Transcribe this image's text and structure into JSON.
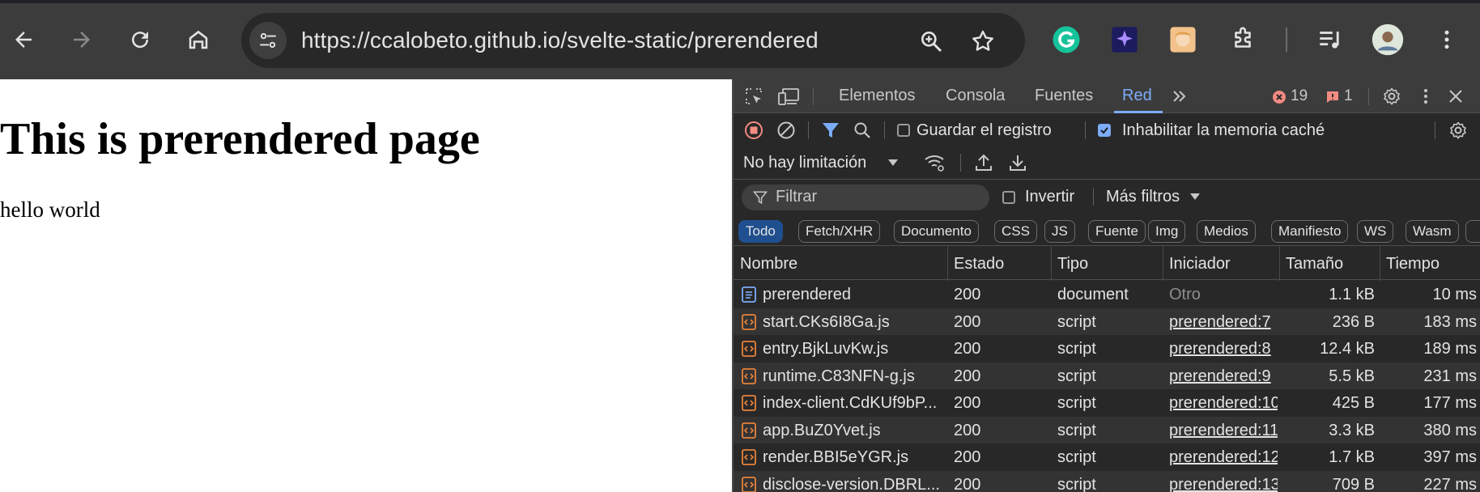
{
  "browser": {
    "url": "https://ccalobeto.github.io/svelte-static/prerendered",
    "icons": {
      "back": "back-arrow-icon",
      "forward": "forward-arrow-icon",
      "reload": "reload-icon",
      "home": "home-icon",
      "site_info": "site-info-icon",
      "zoom": "zoom-icon",
      "bookmark": "star-icon",
      "extensions": "puzzle-icon",
      "media": "media-controls-icon",
      "profile": "avatar",
      "menu": "kebab-menu-icon"
    }
  },
  "page": {
    "heading": "This is prerendered page",
    "paragraph": "hello world"
  },
  "devtools": {
    "tabs": [
      {
        "label": "Elementos"
      },
      {
        "label": "Consola"
      },
      {
        "label": "Fuentes"
      },
      {
        "label": "Red"
      }
    ],
    "error_count": "19",
    "issue_count": "1",
    "preserve_log_label": "Guardar el registro",
    "preserve_log_checked": false,
    "disable_cache_label": "Inhabilitar la memoria caché",
    "disable_cache_checked": true,
    "throttling_label": "No hay limitación",
    "filter_placeholder": "Filtrar",
    "invert_label": "Invertir",
    "more_filters_label": "Más filtros",
    "type_filters": [
      "Todo",
      "Fetch/XHR",
      "Documento",
      "CSS",
      "JS",
      "Fuente",
      "Img",
      "Medios",
      "Manifiesto",
      "WS",
      "Wasm"
    ],
    "columns": [
      "Nombre",
      "Estado",
      "Tipo",
      "Iniciador",
      "Tamaño",
      "Tiempo"
    ],
    "rows": [
      {
        "name": "prerendered",
        "status": "200",
        "type": "document",
        "initiator": "Otro",
        "size": "1.1 kB",
        "time": "10 ms",
        "kind": "document"
      },
      {
        "name": "start.CKs6I8Ga.js",
        "status": "200",
        "type": "script",
        "initiator": "prerendered:7",
        "size": "236 B",
        "time": "183 ms",
        "kind": "script"
      },
      {
        "name": "entry.BjkLuvKw.js",
        "status": "200",
        "type": "script",
        "initiator": "prerendered:8",
        "size": "12.4 kB",
        "time": "189 ms",
        "kind": "script"
      },
      {
        "name": "runtime.C83NFN-g.js",
        "status": "200",
        "type": "script",
        "initiator": "prerendered:9",
        "size": "5.5 kB",
        "time": "231 ms",
        "kind": "script"
      },
      {
        "name": "index-client.CdKUf9bP...",
        "status": "200",
        "type": "script",
        "initiator": "prerendered:10",
        "size": "425 B",
        "time": "177 ms",
        "kind": "script"
      },
      {
        "name": "app.BuZ0Yvet.js",
        "status": "200",
        "type": "script",
        "initiator": "prerendered:11",
        "size": "3.3 kB",
        "time": "380 ms",
        "kind": "script"
      },
      {
        "name": "render.BBI5eYGR.js",
        "status": "200",
        "type": "script",
        "initiator": "prerendered:12",
        "size": "1.7 kB",
        "time": "397 ms",
        "kind": "script"
      },
      {
        "name": "disclose-version.DBRL...",
        "status": "200",
        "type": "script",
        "initiator": "prerendered:13",
        "size": "709 B",
        "time": "227 ms",
        "kind": "script"
      }
    ],
    "colors": {
      "accent": "#7cacf8",
      "error": "#f28b82",
      "script_icon": "#e8833a",
      "document_icon": "#7cacf8"
    }
  }
}
